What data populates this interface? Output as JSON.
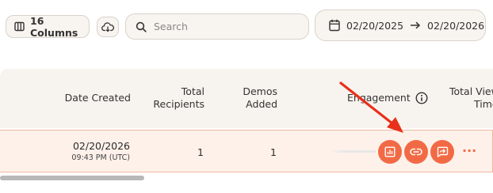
{
  "toolbar": {
    "columns_label": "16 Columns",
    "search_placeholder": "Search",
    "date_start": "02/20/2025",
    "date_end": "02/20/2026"
  },
  "table": {
    "headers": {
      "date_created": "Date Created",
      "total_recipients_1": "Total",
      "total_recipients_2": "Recipients",
      "demos_added_1": "Demos",
      "demos_added_2": "Added",
      "engagement": "Engagement",
      "total_view_1": "Total View",
      "total_view_2": "Time"
    },
    "rows": [
      {
        "date": "02/20/2026",
        "time": "09:43 PM (UTC)",
        "total_recipients": "1",
        "demos_added": "1"
      }
    ]
  },
  "colors": {
    "accent": "#f26a45",
    "annotation_arrow": "#e8301a",
    "header_bg": "#f7f3ee",
    "selected_row_bg": "#fdf1ea"
  },
  "icons": [
    "columns-icon",
    "cloud-download-icon",
    "search-icon",
    "calendar-icon",
    "arrow-right-icon",
    "info-icon",
    "report-icon",
    "link-icon",
    "share-icon",
    "more-icon"
  ]
}
